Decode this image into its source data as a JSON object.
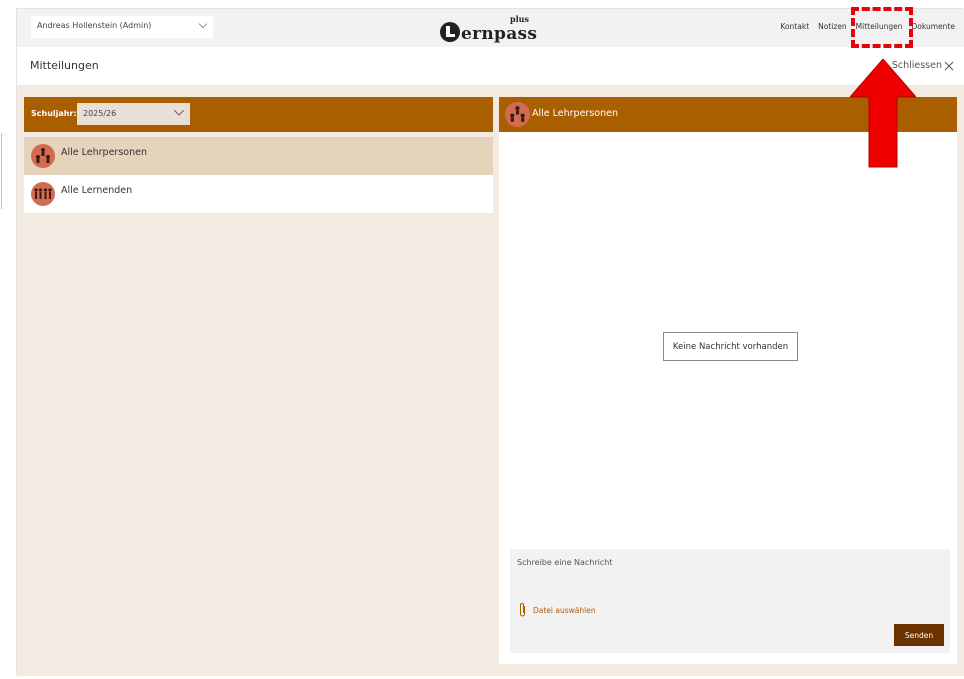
{
  "topbar": {
    "user_select": "Andreas Hollenstein (Admin)",
    "logo_text": "ernpass",
    "logo_plus": "plus",
    "nav": [
      "Kontakt",
      "Notizen",
      "Mitteilungen",
      "Dokumente"
    ]
  },
  "page": {
    "title": "Mitteilungen",
    "close_label": "Schliessen"
  },
  "left": {
    "year_label": "Schuljahr:",
    "year_value": "2025/26",
    "groups": [
      {
        "label": "Alle Lehrpersonen",
        "icon": "teachers-group-icon",
        "selected": true
      },
      {
        "label": "Alle Lernenden",
        "icon": "students-group-icon",
        "selected": false
      }
    ]
  },
  "right": {
    "header_label": "Alle Lehrpersonen",
    "empty_message": "Keine Nachricht vorhanden",
    "composer_placeholder": "Schreibe eine Nachricht",
    "file_label": "Datei auswählen",
    "send_label": "Senden"
  },
  "colors": {
    "accent": "#a95f00",
    "panel_bg": "#f3ebe2",
    "selected_row": "#e6d3bc",
    "avatar": "#d36b52",
    "send_button": "#6b3200",
    "highlight": "#e8000b"
  }
}
